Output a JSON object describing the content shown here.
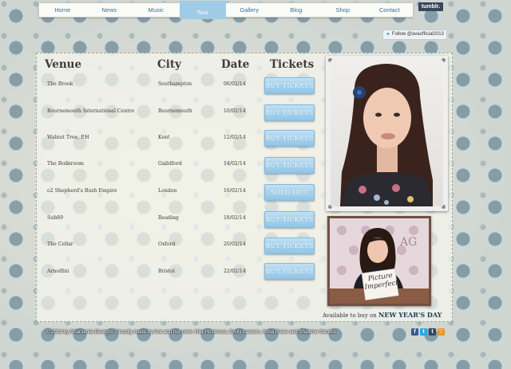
{
  "nav": [
    "Home",
    "News",
    "Music",
    "Tour",
    "Gallery",
    "Blog",
    "Shop",
    "Contact"
  ],
  "nav_active": "Tour",
  "tumblr_label": "tumblr.",
  "follow_label": "Follow @avaofficial2013",
  "headers": {
    "venue": "Venue",
    "city": "City",
    "date": "Date",
    "tickets": "Tickets"
  },
  "rows": [
    {
      "venue": "The Brook",
      "city": "Southampton",
      "date": "06/02/14",
      "ticket": "BUY TICKETS"
    },
    {
      "venue": "Bournemouth International Centre",
      "city": "Bournemouth",
      "date": "10/02/14",
      "ticket": "BUY TICKETS"
    },
    {
      "venue": "Walnut Tree, P.H",
      "city": "Kent",
      "date": "12/02/14",
      "ticket": "BUY TICKETS"
    },
    {
      "venue": "The Boileroom",
      "city": "Guildford",
      "date": "14/02/14",
      "ticket": "BUY TICKETS"
    },
    {
      "venue": "o2 Shepherd's Bush Empire",
      "city": "London",
      "date": "16/02/14",
      "ticket": "SOLD OUT"
    },
    {
      "venue": "Sub89",
      "city": "Reading",
      "date": "18/02/14",
      "ticket": "BUY TICKETS"
    },
    {
      "venue": "The Cellar",
      "city": "Oxford",
      "date": "20/02/14",
      "ticket": "BUY TICKETS"
    },
    {
      "venue": "Arnolfini",
      "city": "Bristol",
      "date": "22/02/14",
      "ticket": "BUY TICKETS"
    }
  ],
  "album_text": [
    "Picture",
    "Imperfect"
  ],
  "available_prefix": "Available to buy on",
  "available_day": "NEW YEAR'S DAY",
  "footer": "© 2013 by Shantanila Designs. Proudly made by Ava and her crew: Hila Hrisimova, Emily Lawson, Anna Rawe and Shallene Gandhi.",
  "social_icons": [
    "facebook-icon",
    "twitter-icon",
    "tumblr-icon",
    "rss-icon"
  ]
}
